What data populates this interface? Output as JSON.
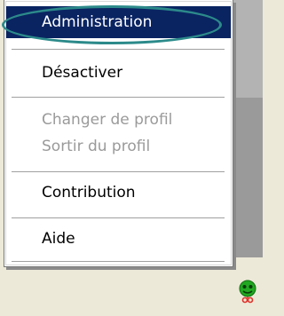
{
  "menu": {
    "items": [
      {
        "label": "Administration",
        "state": "selected"
      },
      {
        "label": "Désactiver",
        "state": "enabled"
      },
      {
        "label": "Changer de profil",
        "state": "disabled"
      },
      {
        "label": "Sortir du profil",
        "state": "disabled"
      },
      {
        "label": "Contribution",
        "state": "enabled"
      },
      {
        "label": "Aide",
        "state": "enabled"
      }
    ]
  },
  "tray": {
    "icon": "green-face-icon",
    "icon_colors": {
      "face": "#22a822",
      "accent": "#e0302a"
    }
  },
  "colors": {
    "selection": "#0a2462",
    "highlight_ring": "#2c8a8a",
    "disabled_text": "#9a9a9a"
  }
}
